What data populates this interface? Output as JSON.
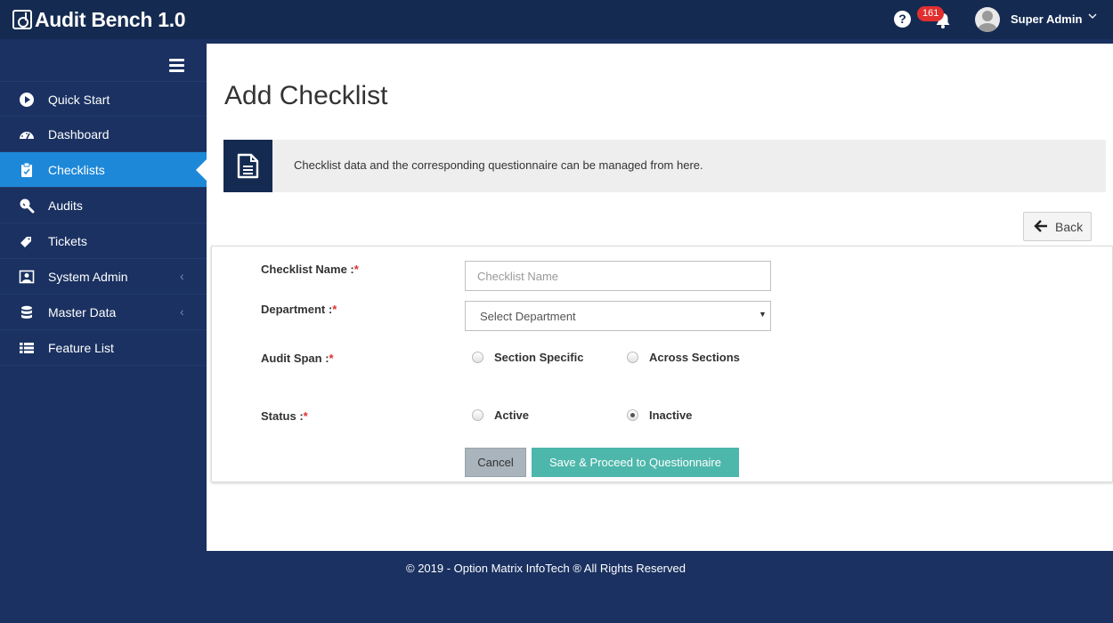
{
  "app": {
    "title": "Audit Bench 1.0"
  },
  "header": {
    "help_glyph": "?",
    "notification_count": "161",
    "user_name": "Super Admin",
    "user_chevron": "⌄"
  },
  "sidebar": {
    "items": [
      {
        "label": "Quick Start",
        "icon": "play-circle-icon"
      },
      {
        "label": "Dashboard",
        "icon": "speedometer-icon"
      },
      {
        "label": "Checklists",
        "icon": "clipboard-icon",
        "active": true
      },
      {
        "label": "Audits",
        "icon": "magnifier-icon"
      },
      {
        "label": "Tickets",
        "icon": "ticket-icon"
      },
      {
        "label": "System Admin",
        "icon": "admin-icon",
        "expandable": true
      },
      {
        "label": "Master Data",
        "icon": "database-icon",
        "expandable": true
      },
      {
        "label": "Feature List",
        "icon": "list-icon"
      }
    ],
    "chevron_glyph": "‹"
  },
  "main": {
    "title": "Add Checklist",
    "info_text": "Checklist data and the corresponding questionnaire can be managed from here.",
    "back_label": "Back",
    "back_glyph": "🡐"
  },
  "form": {
    "required_mark": "*",
    "checklist_name": {
      "label": "Checklist Name :",
      "placeholder": "Checklist Name",
      "value": ""
    },
    "department": {
      "label": "Department :",
      "selected": "Select Department",
      "caret": "▼"
    },
    "audit_span": {
      "label": "Audit Span :",
      "options": [
        "Section Specific",
        "Across Sections"
      ],
      "selected": null
    },
    "status": {
      "label": "Status :",
      "options": [
        "Active",
        "Inactive"
      ],
      "selected": "Inactive"
    },
    "cancel_label": "Cancel",
    "save_label": "Save & Proceed to Questionnaire"
  },
  "footer": {
    "text": "© 2019 - Option Matrix InfoTech ® All Rights Reserved"
  },
  "colors": {
    "topbar": "#142a51",
    "sidebar": "#1a3161",
    "active_item": "#1e88d8",
    "save_button": "#4eb7ab",
    "cancel_button": "#a9b4bd",
    "badge": "#e02f2f"
  }
}
